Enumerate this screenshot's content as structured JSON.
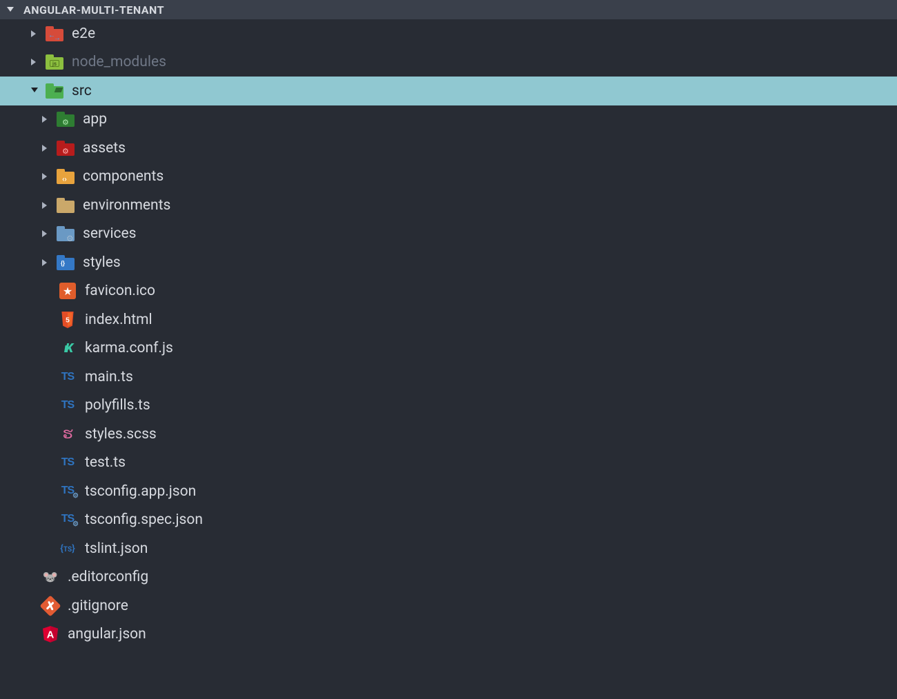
{
  "header": {
    "title": "ANGULAR-MULTI-TENANT",
    "expanded": true
  },
  "tree": [
    {
      "depth": 0,
      "label": "e2e",
      "icon": "e2e-folder",
      "expandable": true,
      "expanded": false,
      "selected": false,
      "dimmed": false
    },
    {
      "depth": 0,
      "label": "node_modules",
      "icon": "node-modules-folder",
      "expandable": true,
      "expanded": false,
      "selected": false,
      "dimmed": true
    },
    {
      "depth": 0,
      "label": "src",
      "icon": "src-folder",
      "expandable": true,
      "expanded": true,
      "selected": true,
      "dimmed": false
    },
    {
      "depth": 1,
      "label": "app",
      "icon": "app-folder",
      "expandable": true,
      "expanded": false,
      "selected": false,
      "dimmed": false
    },
    {
      "depth": 1,
      "label": "assets",
      "icon": "assets-folder",
      "expandable": true,
      "expanded": false,
      "selected": false,
      "dimmed": false
    },
    {
      "depth": 1,
      "label": "components",
      "icon": "components-folder",
      "expandable": true,
      "expanded": false,
      "selected": false,
      "dimmed": false
    },
    {
      "depth": 1,
      "label": "environments",
      "icon": "environments-folder",
      "expandable": true,
      "expanded": false,
      "selected": false,
      "dimmed": false
    },
    {
      "depth": 1,
      "label": "services",
      "icon": "services-folder",
      "expandable": true,
      "expanded": false,
      "selected": false,
      "dimmed": false
    },
    {
      "depth": 1,
      "label": "styles",
      "icon": "styles-folder",
      "expandable": true,
      "expanded": false,
      "selected": false,
      "dimmed": false
    },
    {
      "depth": 1,
      "label": "favicon.ico",
      "icon": "favicon-file",
      "expandable": false,
      "expanded": false,
      "selected": false,
      "dimmed": false
    },
    {
      "depth": 1,
      "label": "index.html",
      "icon": "html-file",
      "expandable": false,
      "expanded": false,
      "selected": false,
      "dimmed": false
    },
    {
      "depth": 1,
      "label": "karma.conf.js",
      "icon": "karma-file",
      "expandable": false,
      "expanded": false,
      "selected": false,
      "dimmed": false
    },
    {
      "depth": 1,
      "label": "main.ts",
      "icon": "ts-file",
      "expandable": false,
      "expanded": false,
      "selected": false,
      "dimmed": false
    },
    {
      "depth": 1,
      "label": "polyfills.ts",
      "icon": "ts-file",
      "expandable": false,
      "expanded": false,
      "selected": false,
      "dimmed": false
    },
    {
      "depth": 1,
      "label": "styles.scss",
      "icon": "scss-file",
      "expandable": false,
      "expanded": false,
      "selected": false,
      "dimmed": false
    },
    {
      "depth": 1,
      "label": "test.ts",
      "icon": "ts-file",
      "expandable": false,
      "expanded": false,
      "selected": false,
      "dimmed": false
    },
    {
      "depth": 1,
      "label": "tsconfig.app.json",
      "icon": "tsconfig-file",
      "expandable": false,
      "expanded": false,
      "selected": false,
      "dimmed": false
    },
    {
      "depth": 1,
      "label": "tsconfig.spec.json",
      "icon": "tsconfig-file",
      "expandable": false,
      "expanded": false,
      "selected": false,
      "dimmed": false
    },
    {
      "depth": 1,
      "label": "tslint.json",
      "icon": "tslint-file",
      "expandable": false,
      "expanded": false,
      "selected": false,
      "dimmed": false
    },
    {
      "depth": 0,
      "label": ".editorconfig",
      "icon": "editorconfig-file",
      "expandable": false,
      "expanded": false,
      "selected": false,
      "dimmed": false
    },
    {
      "depth": 0,
      "label": ".gitignore",
      "icon": "gitignore-file",
      "expandable": false,
      "expanded": false,
      "selected": false,
      "dimmed": false
    },
    {
      "depth": 0,
      "label": "angular.json",
      "icon": "angular-file",
      "expandable": false,
      "expanded": false,
      "selected": false,
      "dimmed": false
    }
  ]
}
